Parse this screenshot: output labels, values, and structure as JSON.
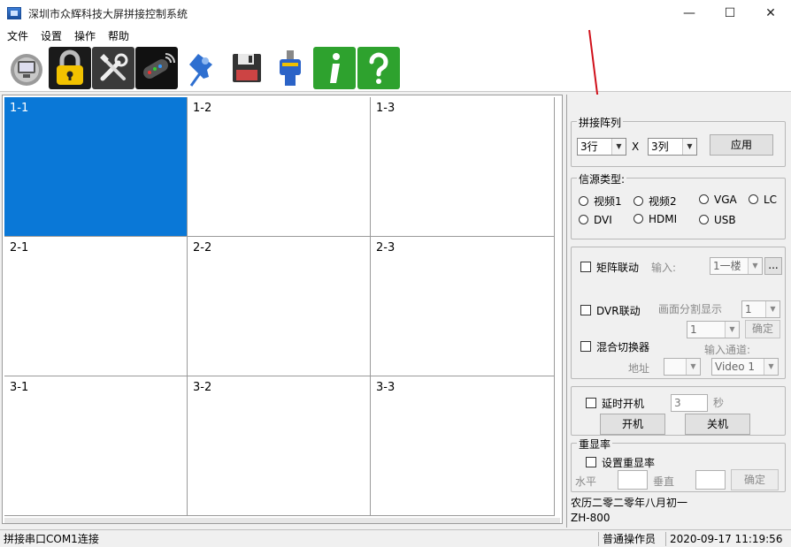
{
  "window": {
    "title": "深圳市众辉科技大屏拼接控制系统",
    "minimize": "—",
    "maximize": "☐",
    "close": "✕"
  },
  "menu": {
    "items": [
      "文件",
      "设置",
      "操作",
      "帮助"
    ]
  },
  "toolbar": {
    "icons": [
      "monitor-icon",
      "lock-icon",
      "tools-icon",
      "remote-icon",
      "pin-icon",
      "save-icon",
      "connector-icon",
      "info-icon",
      "help-icon"
    ]
  },
  "grid": {
    "cells": [
      "1-1",
      "1-2",
      "1-3",
      "2-1",
      "2-2",
      "2-3",
      "3-1",
      "3-2",
      "3-3"
    ],
    "selected": "1-1"
  },
  "panel": {
    "array": {
      "legend": "拼接阵列",
      "rows": "3行",
      "sep": "X",
      "cols": "3列",
      "apply": "应用"
    },
    "source": {
      "legend": "信源类型:",
      "options": [
        "视频1",
        "视频2",
        "VGA",
        "LC",
        "DVI",
        "HDMI",
        "USB"
      ]
    },
    "matrix": {
      "label": "矩阵联动",
      "input_label": "输入:",
      "input_value": "1一楼",
      "more": "..."
    },
    "dvr": {
      "label": "DVR联动",
      "split_label": "画面分割显示",
      "split_value": "1",
      "channel_value": "1",
      "confirm": "确定"
    },
    "mixer": {
      "label": "混合切换器",
      "channel_label": "输入通道:",
      "address_label": "地址",
      "address_value": "",
      "channel_value": "Video 1"
    },
    "power": {
      "label": "延时开机",
      "delay": "3",
      "unit": "秒",
      "on": "开机",
      "off": "关机"
    },
    "refresh": {
      "legend": "重显率",
      "label": "设置重显率",
      "h_label": "水平",
      "v_label": "垂直",
      "confirm": "确定"
    },
    "lunar_date": "农历二零二零年八月初一",
    "model": "ZH-800"
  },
  "status": {
    "connection": "拼接串口COM1连接",
    "user": "普通操作员",
    "datetime": "2020-09-17 11:19:56"
  },
  "colors": {
    "selected": "#0a78d7",
    "arrow": "#d0101a"
  }
}
